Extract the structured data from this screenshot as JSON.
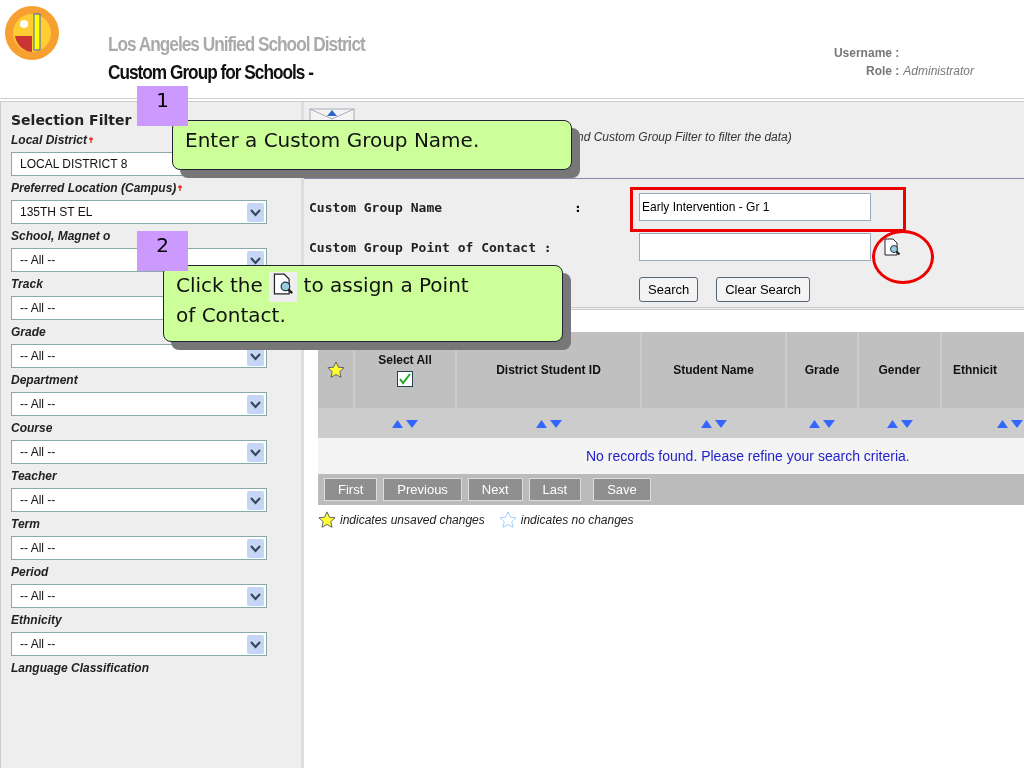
{
  "header": {
    "org_name": "Los Angeles Unified School District",
    "page_title": "Custom Group for Schools -",
    "username_label": "Username :",
    "role_label": "Role :",
    "role_value": "Administrator"
  },
  "sidebar": {
    "title": "Selection Filter",
    "filters": [
      {
        "label": "Local District",
        "required": true,
        "value": "LOCAL DISTRICT 8",
        "arrow": false
      },
      {
        "label": "Preferred Location (Campus)",
        "required": true,
        "value": "135TH ST EL"
      },
      {
        "label": "School, Magnet o",
        "required": false,
        "value": "-- All --"
      },
      {
        "label": "Track",
        "required": false,
        "value": "-- All --",
        "arrow": false
      },
      {
        "label": "Grade",
        "required": false,
        "value": "-- All --"
      },
      {
        "label": "Department",
        "required": false,
        "value": "-- All --"
      },
      {
        "label": "Course",
        "required": false,
        "value": "-- All --"
      },
      {
        "label": "Teacher",
        "required": false,
        "value": "-- All --"
      },
      {
        "label": "Term",
        "required": false,
        "value": "-- All --"
      },
      {
        "label": "Period",
        "required": false,
        "value": "-- All --"
      },
      {
        "label": "Ethnicity",
        "required": false,
        "value": "-- All --"
      }
    ],
    "last_label": "Language Classification"
  },
  "main": {
    "hint": "nd Custom Group Filter to filter the data)",
    "form": [
      {
        "label": "Custom Group Name",
        "colon": ":",
        "value": "Early Intervention - Gr 1",
        "lookup": false
      },
      {
        "label": "Custom Group Point of Contact :",
        "lookup": true
      }
    ],
    "buttons": [
      "Search",
      "Clear Search"
    ],
    "table": {
      "columns": [
        {
          "kind": "star"
        },
        {
          "kind": "select",
          "label": "Select All",
          "checked": true
        },
        {
          "kind": "text",
          "label": "District Student ID"
        },
        {
          "kind": "text",
          "label": "Student Name"
        },
        {
          "kind": "text",
          "label": "Grade"
        },
        {
          "kind": "text",
          "label": "Gender"
        },
        {
          "kind": "text",
          "label": "Ethnicit"
        }
      ],
      "empty_message": "No records found. Please refine your search criteria.",
      "pager": [
        {
          "label": "First",
          "disabled": true
        },
        {
          "label": "Previous",
          "disabled": true
        },
        {
          "label": "Next",
          "disabled": true
        },
        {
          "label": "Last",
          "disabled": true
        },
        {
          "label": "Save",
          "disabled": true
        }
      ]
    },
    "legend": [
      {
        "filled": true,
        "text": "indicates unsaved changes"
      },
      {
        "filled": false,
        "text": "indicates no changes"
      }
    ]
  },
  "callouts": [
    {
      "number": "1",
      "text": "Enter a Custom Group Name."
    },
    {
      "number": "2",
      "segments": [
        "Click the",
        "to assign a Point",
        "of Contact."
      ]
    }
  ]
}
